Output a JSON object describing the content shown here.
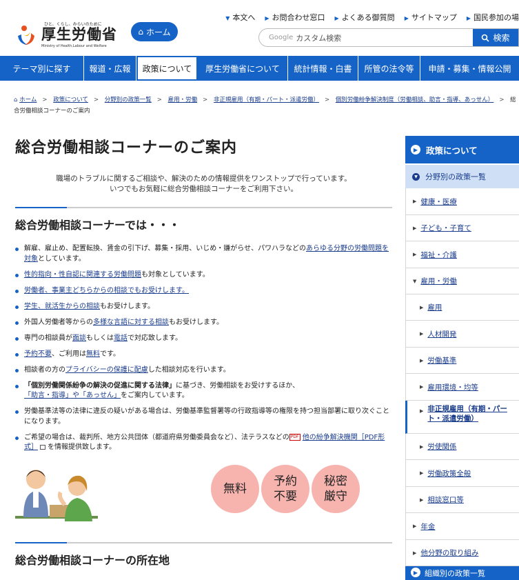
{
  "header": {
    "logo_tagline": "ひと、くらし、みらいのために",
    "logo_name": "厚生労働省",
    "logo_english": "Ministry of Health,Labour and Welfare",
    "home_label": "ホーム",
    "top_links": [
      "本文へ",
      "お問合わせ窓口",
      "よくある御質問",
      "サイトマップ",
      "国民参加の場"
    ],
    "search_brand": "Google",
    "search_placeholder": "カスタム検索",
    "search_button": "検索"
  },
  "gnav": {
    "items": [
      "テーマ別に探す",
      "報道・広報",
      "政策について",
      "厚生労働省について",
      "統計情報・白書",
      "所管の法令等",
      "申請・募集・情報公開"
    ],
    "active_index": 2
  },
  "breadcrumb": {
    "items": [
      "ホーム",
      "政策について",
      "分野別の政策一覧",
      "雇用・労働",
      "非正規雇用（有期・パート・派遣労働）",
      "個別労働紛争解決制度（労働相談、助言・指導、あっせん）",
      "総"
    ],
    "current": "合労働相談コーナーのご案内"
  },
  "main": {
    "title": "総合労働相談コーナーのご案内",
    "lead_line1": "職場のトラブルに関するご相談や、解決のための情報提供をワンストップで行っています。",
    "lead_line2": "いつでもお気軽に総合労働相談コーナーをご利用下さい。",
    "section1_title": "総合労働相談コーナーでは・・・",
    "bullets": {
      "b1_text": "解雇、雇止め、配置転換、賃金の引下げ、募集・採用、いじめ・嫌がらせ、パワハラなどの",
      "b1_link": "あらゆる分野の労働問題を対象",
      "b1_tail": "としています。",
      "b2_link": "性的指向・性自認に関連する労働問題",
      "b2_tail": "も対象としています。",
      "b3_link": "労働者、事業主どちらからの相談でもお受けします。",
      "b4_link": "学生、就活生からの相談",
      "b4_tail": "もお受けします。",
      "b5_text": "外国人労働者等からの",
      "b5_link": "多様な言語に対する相談",
      "b5_tail": "もお受けします。",
      "b6_text": "専門の相談員が",
      "b6_link1": "面談",
      "b6_mid": "もしくは",
      "b6_link2": "電話",
      "b6_tail": "で対応致します。",
      "b7_link1": "予約不要",
      "b7_mid": "、ご利用は",
      "b7_link2": "無料",
      "b7_tail": "です。",
      "b8_text": "相談者の方の",
      "b8_link": "プライバシーの保護に配慮",
      "b8_tail": "した相談対応を行います。",
      "b9_bold": "「個別労働関係紛争の解決の促進に関する法律」",
      "b9_text": "に基づき、労働相談をお受けするほか、",
      "b9_link": "「助言・指導」や「あっせん」",
      "b9_tail": "をご案内しています。",
      "b10_text": "労働基準法等の法律に違反の疑いがある場合は、労働基準監督署等の行政指導等の権限を持つ担当部署に取り次ぐことになります。",
      "b11_text": "ご希望の場合は、裁判所、地方公共団体（都道府県労働委員会など）、法テラスなどの",
      "b11_pdf": "PDF",
      "b11_link": "他の紛争解決機関［PDF形式］",
      "b11_tail": "を情報提供致します。"
    },
    "badges": [
      "無料",
      "予約\n不要",
      "秘密\n厳守"
    ],
    "section2_title": "総合労働相談コーナーの所在地"
  },
  "sidebar": {
    "head": "政策について",
    "sub": "分野別の政策一覧",
    "items": [
      "健康・医療",
      "子ども・子育て",
      "福祉・介護",
      "雇用・労働",
      "雇用",
      "人材開発",
      "労働基準",
      "雇用環境・均等",
      "非正規雇用（有期・パート・派遣労働）",
      "労使関係",
      "労働政策全般",
      "相談窓口等",
      "年金",
      "他分野の取り組み"
    ],
    "bottom": "組織別の政策一覧"
  },
  "colors": {
    "primary": "#1663c7",
    "badge": "#f7b3ae",
    "sidebar_sub": "#cfe0f6"
  }
}
